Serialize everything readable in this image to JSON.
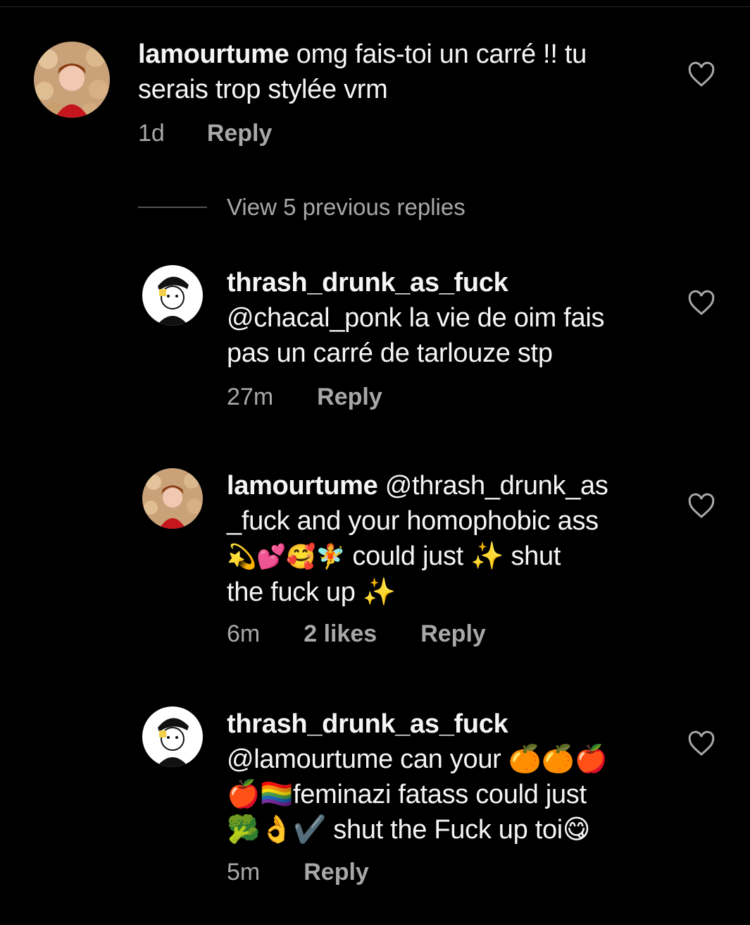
{
  "comments": [
    {
      "username": "lamourtume",
      "text": " omg fais-toi un carré !! tu serais trop stylée vrm",
      "time": "1d",
      "likes": "",
      "reply_label": "Reply"
    },
    {
      "username": "thrash_drunk_as_fuck",
      "text": "@chacal_ponk la vie de oim fais pas un carré de tarlouze stp",
      "time": "27m",
      "likes": "",
      "reply_label": "Reply"
    },
    {
      "username": "lamourtume",
      "text_part1": " @thrash_drunk_as",
      "text_part2": "_fuck and your homophobic ass",
      "text_part3_emoji": "💫💕🥰🧚",
      "text_part3": " could just ✨ shut",
      "text_part4": "the fuck up ✨",
      "time": "6m",
      "likes": "2 likes",
      "reply_label": "Reply"
    },
    {
      "username": "thrash_drunk_as_fuck",
      "text_line1": "@lamourtume can your 🍊🍊🍎",
      "text_line2": "🍎🏳️‍🌈feminazi fatass could just",
      "text_line3": "🥦👌✔️ shut the Fuck up toi😋",
      "time": "5m",
      "likes": "",
      "reply_label": "Reply"
    }
  ],
  "view_previous_replies": "View 5 previous replies",
  "colors": {
    "background": "#000000",
    "text_primary": "#f5f5f5",
    "text_secondary": "#a8a8a8"
  },
  "icons": {
    "like": "heart-outline-icon"
  }
}
